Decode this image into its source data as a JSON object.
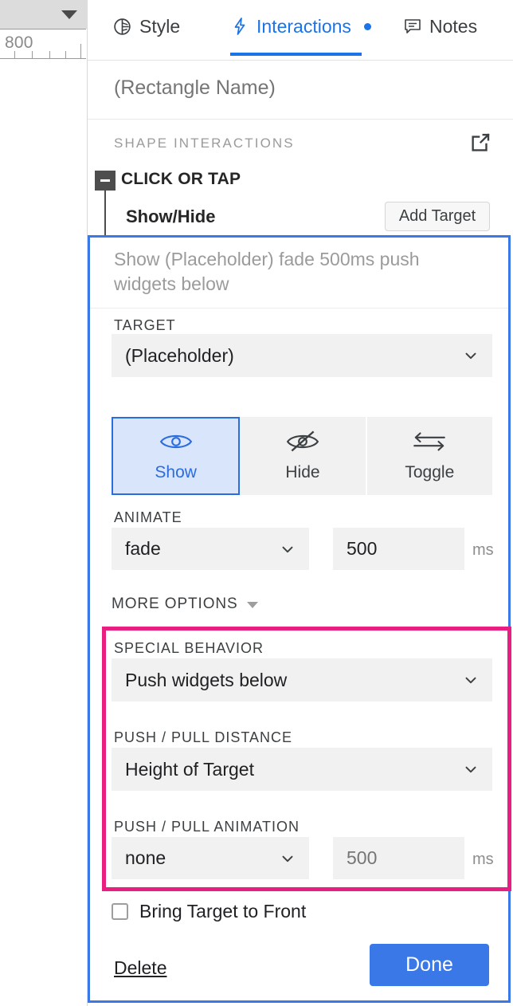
{
  "ruler": {
    "value": "800",
    "caret_icon": "caret-down-icon"
  },
  "tabs": [
    {
      "label": "Style",
      "icon": "style-icon",
      "active": false
    },
    {
      "label": "Interactions",
      "icon": "lightning-bolt-icon",
      "active": true
    },
    {
      "label": "Notes",
      "icon": "note-bubble-icon",
      "active": false
    }
  ],
  "shape_name": {
    "value": "",
    "placeholder": "(Rectangle Name)"
  },
  "shape_interactions": {
    "heading": "SHAPE INTERACTIONS",
    "popout_icon": "open-in-new-icon"
  },
  "event": {
    "title": "CLICK OR TAP",
    "collapse_icon": "minus-icon",
    "case_title": "Show/Hide",
    "add_target_label": "Add Target"
  },
  "action_editor": {
    "summary": "Show (Placeholder) fade 500ms push widgets below",
    "target": {
      "label": "TARGET",
      "value": "(Placeholder)",
      "chevron_icon": "chevron-down-icon"
    },
    "visibility_modes": [
      {
        "label": "Show",
        "icon": "eye-icon",
        "active": true
      },
      {
        "label": "Hide",
        "icon": "eye-off-icon",
        "active": false
      },
      {
        "label": "Toggle",
        "icon": "toggle-arrows-icon",
        "active": false
      }
    ],
    "animate": {
      "label": "ANIMATE",
      "value": "fade",
      "chevron_icon": "chevron-down-icon",
      "duration": "500",
      "duration_unit": "ms"
    },
    "more_options": {
      "label": "MORE OPTIONS",
      "caret_icon": "caret-down-icon"
    },
    "special_behavior": {
      "label": "SPECIAL BEHAVIOR",
      "value": "Push widgets below",
      "chevron_icon": "chevron-down-icon"
    },
    "push_pull_distance": {
      "label": "PUSH / PULL DISTANCE",
      "value": "Height of Target",
      "chevron_icon": "chevron-down-icon"
    },
    "push_pull_animation": {
      "label": "PUSH / PULL ANIMATION",
      "value": "none",
      "chevron_icon": "chevron-down-icon",
      "duration": "",
      "duration_placeholder": "500",
      "duration_unit": "ms"
    },
    "bring_to_front": {
      "label": "Bring Target to Front",
      "checked": false,
      "icon": "checkbox-unchecked-icon"
    },
    "delete_label": "Delete",
    "done_label": "Done"
  },
  "colors": {
    "accent_blue": "#1a73e8",
    "highlight_blue": "#3b78e7",
    "highlight_pink": "#e91e81",
    "field_gray": "#f1f1f1",
    "text_dark": "#202124",
    "text_muted": "#9b9b9b"
  }
}
